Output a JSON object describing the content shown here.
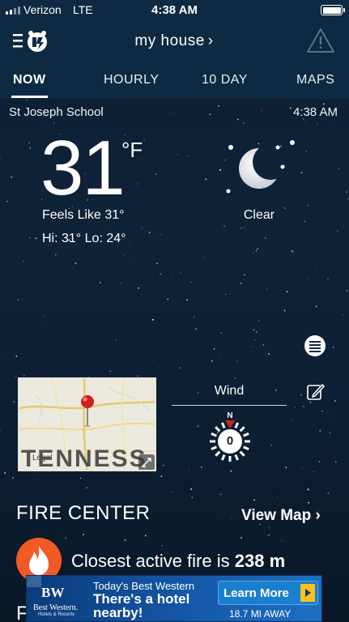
{
  "status_bar": {
    "carrier": "Verizon",
    "network": "LTE",
    "time": "4:38 AM"
  },
  "header": {
    "location": "my house",
    "chevron": "›",
    "menu_icon": "menu-app-icon",
    "alert_icon": "warning-triangle-icon"
  },
  "tabs": [
    {
      "label": "NOW",
      "active": true
    },
    {
      "label": "HOURLY",
      "active": false
    },
    {
      "label": "10 DAY",
      "active": false
    },
    {
      "label": "MAPS",
      "active": false
    }
  ],
  "current": {
    "station": "St Joseph School",
    "updated": "4:38 AM",
    "temperature": "31",
    "unit": "°F",
    "feels_like": "Feels Like 31°",
    "hi_lo": "Hi: 31° Lo: 24°",
    "condition": "Clear",
    "condition_icon": "moon-stars-icon"
  },
  "map_card": {
    "state_label": "TENNESS",
    "legal": "Legal"
  },
  "wind": {
    "label": "Wind",
    "direction": "N",
    "speed": "0"
  },
  "fire_center": {
    "title": "FIRE CENTER",
    "view_map": "View Map",
    "view_map_chevron": "›",
    "closest_prefix": "Closest active fire is",
    "closest_distance": "238 m",
    "next_section_peek": "F"
  },
  "ad": {
    "brand": "BW",
    "brand_name": "Best Western.",
    "brand_sub": "Hotels & Resorts",
    "kicker": "Today's Best Western",
    "headline": "There's a hotel nearby!",
    "cta": "Learn More",
    "distance": "18.7 MI AWAY"
  },
  "colors": {
    "background": "#0c1f35",
    "header": "#0d2a42",
    "fire_accent": "#f15a24",
    "wind_needle": "#d0211b",
    "ad_blue": "#0b3b7a",
    "ad_cta_arrow": "#ffc21a"
  }
}
